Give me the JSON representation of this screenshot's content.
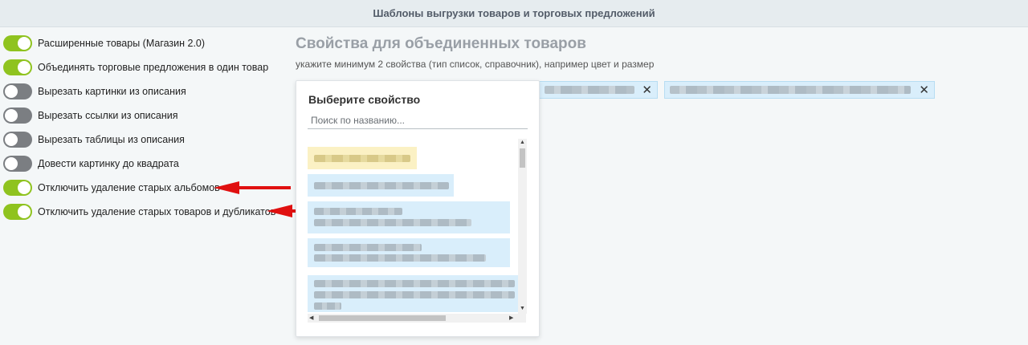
{
  "header": {
    "title": "Шаблоны выгрузки товаров и торговых предложений"
  },
  "options": [
    {
      "label": "Расширенные товары (Магазин 2.0)",
      "enabled": true
    },
    {
      "label": "Объединять торговые предложения в один товар",
      "enabled": true
    },
    {
      "label": "Вырезать картинки из описания",
      "enabled": false
    },
    {
      "label": "Вырезать ссылки из описания",
      "enabled": false
    },
    {
      "label": "Вырезать таблицы из описания",
      "enabled": false
    },
    {
      "label": "Довести картинку до квадрата",
      "enabled": false
    },
    {
      "label": "Отключить удаление старых альбомов",
      "enabled": true
    },
    {
      "label": "Отключить удаление старых товаров и дубликатов",
      "enabled": true
    }
  ],
  "colors": {
    "toggle_on": "#8fc31f",
    "toggle_off": "#7b7e82",
    "arrow": "#e01010",
    "tag_bg": "#d9eefb",
    "highlight": "#fbf1c4"
  },
  "properties": {
    "title": "Свойства для объединенных товаров",
    "hint": "укажите минимум 2 свойства (тип список, справочник), например цвет и размер",
    "remove_icon": "close-icon"
  },
  "dropdown": {
    "title": "Выберите свойство",
    "search_placeholder": "Поиск по названию..."
  }
}
